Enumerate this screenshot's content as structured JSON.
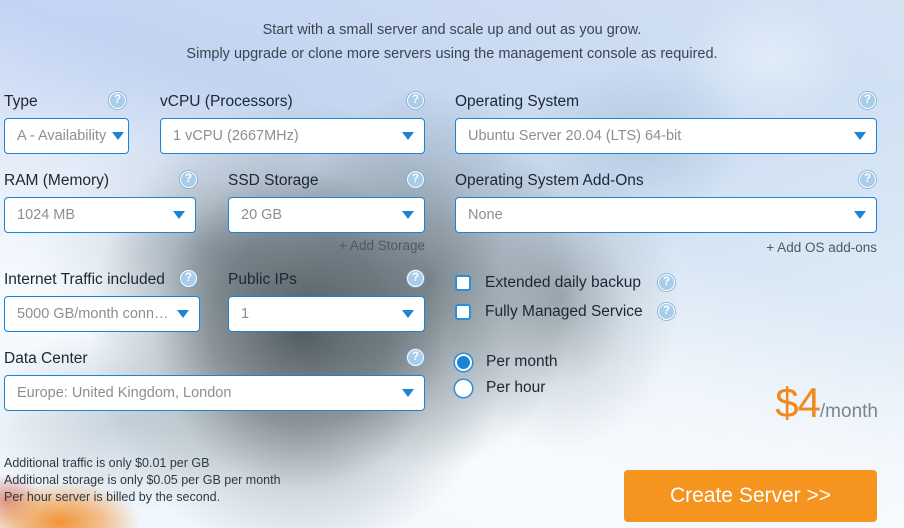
{
  "intro": {
    "line1": "Start with a small server and scale up and out as you grow.",
    "line2": "Simply upgrade or clone more servers using the management console as required."
  },
  "help_glyph": "?",
  "fields": {
    "type": {
      "label": "Type",
      "value": "A - Availability"
    },
    "vcpu": {
      "label": "vCPU (Processors)",
      "value": "1 vCPU (2667MHz)"
    },
    "os": {
      "label": "Operating System",
      "value": "Ubuntu Server 20.04 (LTS) 64-bit"
    },
    "ram": {
      "label": "RAM (Memory)",
      "value": "1024 MB"
    },
    "ssd": {
      "label": "SSD Storage",
      "value": "20 GB"
    },
    "os_addons": {
      "label": "Operating System Add-Ons",
      "value": "None"
    },
    "traffic": {
      "label": "Internet Traffic included",
      "value": "5000 GB/month conne…"
    },
    "public_ips": {
      "label": "Public IPs",
      "value": "1"
    },
    "datacenter": {
      "label": "Data Center",
      "value": "Europe: United Kingdom, London"
    }
  },
  "links": {
    "add_storage": "+ Add Storage",
    "add_os_addons": "+ Add OS add-ons"
  },
  "options": {
    "extended_backup": "Extended daily backup",
    "fully_managed": "Fully Managed Service"
  },
  "billing": {
    "per_month": "Per month",
    "per_hour": "Per hour"
  },
  "price": {
    "amount": "$4",
    "period": "/month"
  },
  "notes": {
    "line1": "Additional traffic is only $0.01 per GB",
    "line2": "Additional storage is only $0.05 per GB per month",
    "line3": "Per hour server is billed by the second."
  },
  "cta": {
    "label": "Create Server >>"
  },
  "colors": {
    "accent_blue": "#1b84d4",
    "orange": "#f5941f",
    "price_orange": "#f08a1e"
  }
}
